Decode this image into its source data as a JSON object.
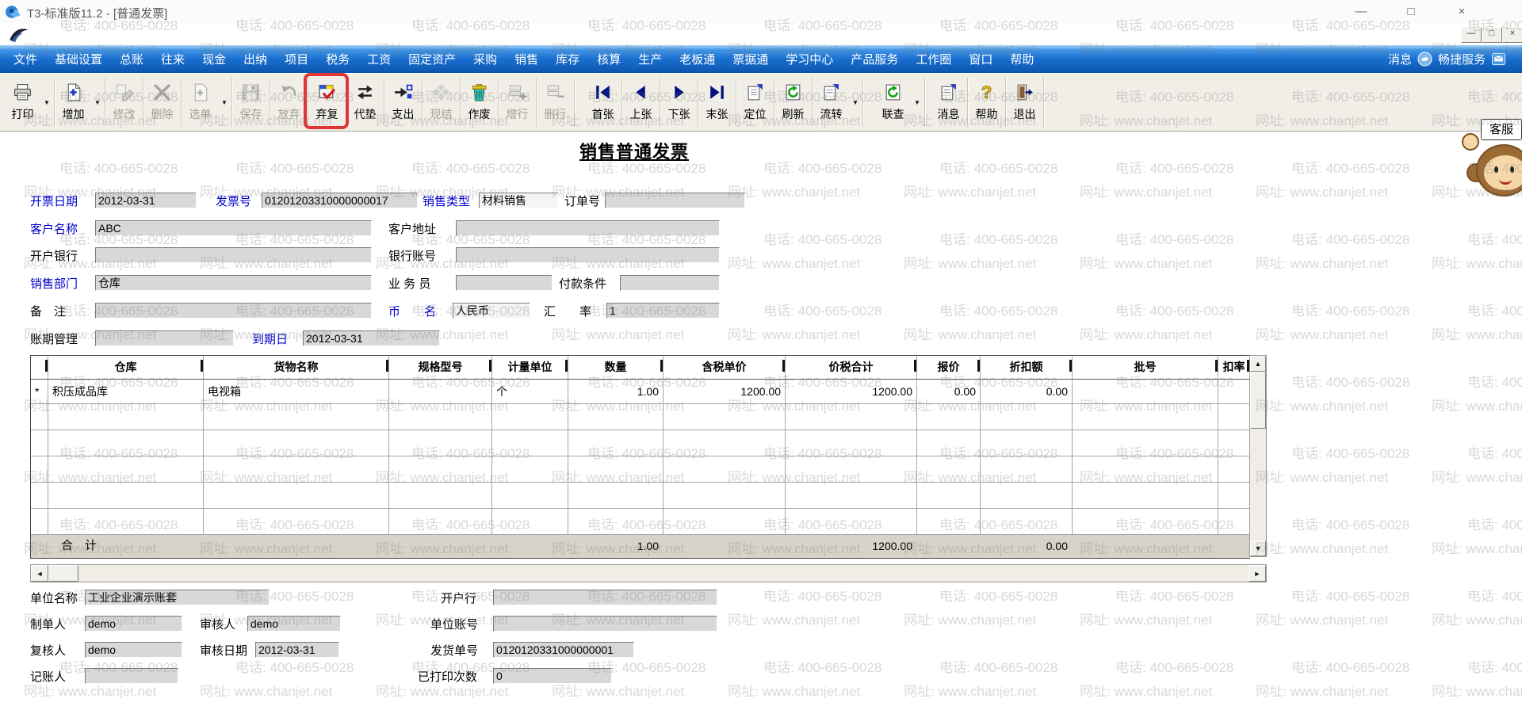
{
  "titlebar": {
    "title": "T3-标准版11.2 - [普通发票]",
    "controls": [
      "minimize-icon",
      "maximize-icon",
      "close-icon"
    ],
    "mdi_controls": [
      "minimize-icon",
      "restore-icon",
      "close-icon"
    ]
  },
  "watermark": {
    "phone_text": "电话: 400-665-0028",
    "site_text": "网址: www.chanjet.net"
  },
  "menu": {
    "items": [
      "文件",
      "基础设置",
      "总账",
      "往来",
      "现金",
      "出纳",
      "项目",
      "税务",
      "工资",
      "固定资产",
      "采购",
      "销售",
      "库存",
      "核算",
      "生产",
      "老板通",
      "票据通",
      "学习中心",
      "产品服务",
      "工作圈",
      "窗口",
      "帮助"
    ],
    "right": [
      {
        "label": "消息",
        "icon": "dove-icon"
      },
      {
        "label": "畅捷服务",
        "icon": "service-window-icon"
      }
    ]
  },
  "toolbar": {
    "kefu_button": "客服",
    "buttons": [
      {
        "label": "打印",
        "icon": "printer-icon",
        "disabled": false,
        "dropdown": true
      },
      {
        "label": "增加",
        "icon": "add-doc-icon",
        "disabled": false,
        "dropdown": true
      },
      {
        "label": "修改",
        "icon": "edit-icon",
        "disabled": true
      },
      {
        "label": "删除",
        "icon": "delete-x-icon",
        "disabled": true
      },
      {
        "label": "选单",
        "icon": "select-doc-icon",
        "disabled": true,
        "dropdown": true
      },
      {
        "label": "保存",
        "icon": "save-floppy-icon",
        "disabled": true
      },
      {
        "label": "放弃",
        "icon": "undo-icon",
        "disabled": true
      },
      {
        "label": "弃复",
        "icon": "unreview-check-icon",
        "disabled": false,
        "highlighted": true
      },
      {
        "label": "代垫",
        "icon": "route-arrows-icon",
        "disabled": false
      },
      {
        "label": "支出",
        "icon": "payout-arrow-icon",
        "disabled": false
      },
      {
        "label": "现结",
        "icon": "settle-icon",
        "disabled": true
      },
      {
        "label": "作废",
        "icon": "void-trash-icon",
        "disabled": false
      },
      {
        "label": "增行",
        "icon": "add-row-icon",
        "disabled": true
      },
      {
        "label": "删行",
        "icon": "delete-row-icon",
        "disabled": true
      },
      {
        "label": "首张",
        "icon": "first-page-icon",
        "disabled": false
      },
      {
        "label": "上张",
        "icon": "prev-page-icon",
        "disabled": false
      },
      {
        "label": "下张",
        "icon": "next-page-icon",
        "disabled": false
      },
      {
        "label": "末张",
        "icon": "last-page-icon",
        "disabled": false
      },
      {
        "label": "定位",
        "icon": "locate-doc-icon",
        "disabled": false
      },
      {
        "label": "刷新",
        "icon": "refresh-icon",
        "disabled": false
      },
      {
        "label": "流转",
        "icon": "flow-icon",
        "disabled": false,
        "dropdown": true
      },
      {
        "label": "联查",
        "icon": "linked-query-icon",
        "disabled": false,
        "dropdown": true
      },
      {
        "label": "消息",
        "icon": "message-doc-icon",
        "disabled": false
      },
      {
        "label": "帮助",
        "icon": "help-icon",
        "disabled": false
      },
      {
        "label": "退出",
        "icon": "exit-door-icon",
        "disabled": false
      }
    ]
  },
  "form": {
    "title": "销售普通发票",
    "fields": [
      {
        "id": "invoice_date",
        "label": "开票日期",
        "value": "2012-03-31",
        "blue": true
      },
      {
        "id": "invoice_no",
        "label": "发票号",
        "value": "01201203310000000017",
        "blue": true
      },
      {
        "id": "sale_type",
        "label": "销售类型",
        "value": "材料销售",
        "blue": true
      },
      {
        "id": "order_no",
        "label": "订单号",
        "value": "",
        "blue": false
      },
      {
        "id": "customer_name",
        "label": "客户名称",
        "value": "ABC",
        "blue": true
      },
      {
        "id": "customer_addr",
        "label": "客户地址",
        "value": "",
        "blue": false
      },
      {
        "id": "bank_name",
        "label": "开户银行",
        "value": "",
        "blue": false
      },
      {
        "id": "bank_account",
        "label": "银行账号",
        "value": "",
        "blue": false
      },
      {
        "id": "sales_dept",
        "label": "销售部门",
        "value": "仓库",
        "blue": true
      },
      {
        "id": "salesman",
        "label": "业 务 员",
        "value": "",
        "blue": false
      },
      {
        "id": "payment_terms",
        "label": "付款条件",
        "value": "",
        "blue": false
      },
      {
        "id": "remark",
        "label": "备　注",
        "value": "",
        "blue": false
      },
      {
        "id": "currency",
        "label": "币　　名",
        "value": "人民币",
        "blue": true
      },
      {
        "id": "exchange_rate",
        "label": "汇　　率",
        "value": "1",
        "blue": false
      },
      {
        "id": "credit_period",
        "label": "账期管理",
        "value": "",
        "blue": false
      },
      {
        "id": "due_date",
        "label": "到期日",
        "value": "2012-03-31",
        "blue": true
      }
    ]
  },
  "table": {
    "columns": [
      "仓库",
      "货物名称",
      "规格型号",
      "计量单位",
      "数量",
      "含税单价",
      "价税合计",
      "报价",
      "折扣额",
      "批号",
      "扣率"
    ],
    "rows": [
      {
        "marker": "*",
        "cells": [
          "积压成品库",
          "电视箱",
          "",
          "个",
          "1.00",
          "1200.00",
          "1200.00",
          "0.00",
          "0.00",
          "",
          ""
        ]
      }
    ],
    "total": {
      "label": "合　计",
      "values": {
        "数量": "1.00",
        "价税合计": "1200.00",
        "折扣额": "0.00"
      }
    }
  },
  "footer": {
    "fields": [
      {
        "id": "unit_name",
        "label": "单位名称",
        "value": "工业企业演示账套"
      },
      {
        "id": "open_bank",
        "label": "开户行",
        "value": ""
      },
      {
        "id": "creator",
        "label": "制单人",
        "value": "demo"
      },
      {
        "id": "auditor",
        "label": "审核人",
        "value": "demo"
      },
      {
        "id": "unit_account",
        "label": "单位账号",
        "value": ""
      },
      {
        "id": "reviewer",
        "label": "复核人",
        "value": "demo"
      },
      {
        "id": "audit_date",
        "label": "审核日期",
        "value": "2012-03-31"
      },
      {
        "id": "delivery_no",
        "label": "发货单号",
        "value": "0120120331000000001"
      },
      {
        "id": "bookkeeper",
        "label": "记账人",
        "value": ""
      },
      {
        "id": "print_count",
        "label": "已打印次数",
        "value": "0"
      }
    ]
  }
}
